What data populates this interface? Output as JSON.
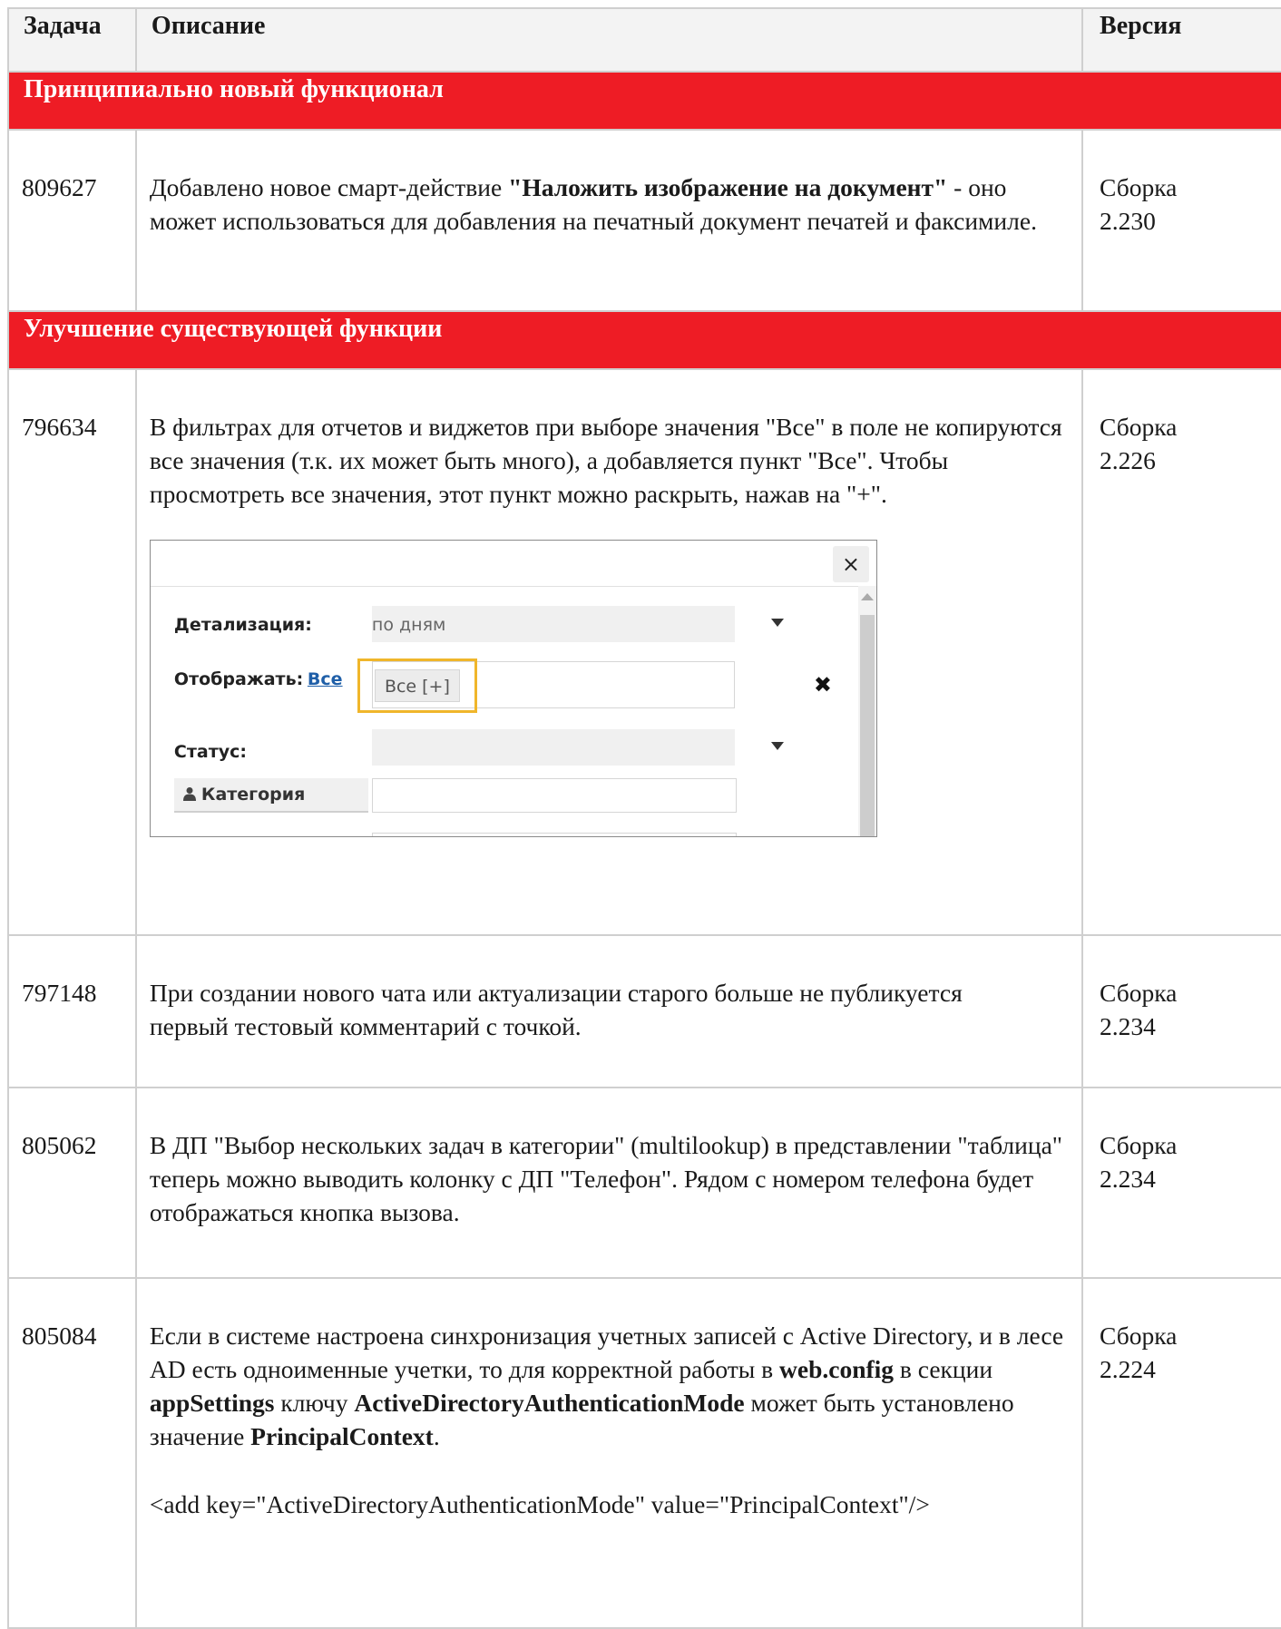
{
  "header": {
    "task": "Задача",
    "description": "Описание",
    "version": "Версия"
  },
  "sections": [
    {
      "title": "Принципиально новый функционал"
    },
    {
      "title": "Улучшение существующей функции"
    }
  ],
  "rows": [
    {
      "task": "809627",
      "desc_plain_1": "Добавлено новое смарт-действие ",
      "desc_bold_1": "\"Наложить изображение на документ\"",
      "desc_plain_2": " - оно может использоваться для добавления на печатный документ печатей и факсимиле.",
      "version": "Сборка 2.230"
    },
    {
      "task": "796634",
      "desc": "В фильтрах для отчетов и виджетов при выборе значения \"Все\" в поле не копируются все значения (т.к. их может быть много), а добавляется пункт \"Все\". Чтобы просмотреть все значения, этот пункт можно раскрыть, нажав на \"+\".",
      "version": "Сборка 2.226"
    },
    {
      "task": "797148",
      "desc": "При создании нового чата или актуализации старого больше не публикуется первый тестовый комментарий с точкой.",
      "version": "Сборка 2.234"
    },
    {
      "task": "805062",
      "desc": "В ДП \"Выбор нескольких задач в категории\" (multilookup) в представлении \"таблица\" теперь можно выводить колонку с ДП \"Телефон\". Рядом с номером телефона будет отображаться кнопка вызова.",
      "version": "Сборка 2.234"
    },
    {
      "task": "805084",
      "desc_1": "Если в системе настроена синхронизация учетных записей с Active Directory, и в лесе AD есть одноименные учетки, то для корректной работы в ",
      "desc_b1": "web.config",
      "desc_2": " в секции ",
      "desc_b2": "appSettings",
      "desc_3": " ключу ",
      "desc_b3": "ActiveDirectoryAuthenticationMode",
      "desc_4": " может быть установлено значение ",
      "desc_b4": "PrincipalContext",
      "desc_5": ".",
      "code": "<add key=\"ActiveDirectoryAuthenticationMode\" value=\"PrincipalContext\"/>",
      "version": "Сборка 2.224"
    }
  ],
  "dialog": {
    "close_glyph": "×",
    "detail_label": "Детализация:",
    "detail_value": "по дням",
    "show_label": "Отображать:",
    "show_link": "Все",
    "chip": "Все [+]",
    "remove_glyph": "✖",
    "status_label": "Статус:",
    "category_label": "Категория",
    "icons": {
      "close": "close-icon",
      "dropdown": "chevron-down-icon",
      "remove": "remove-icon",
      "user": "user-icon"
    },
    "highlight_color": "#f0b62b"
  },
  "colors": {
    "section_bg": "#ee1c25",
    "header_bg": "#f3f3f3",
    "border": "#cfcfcf"
  }
}
